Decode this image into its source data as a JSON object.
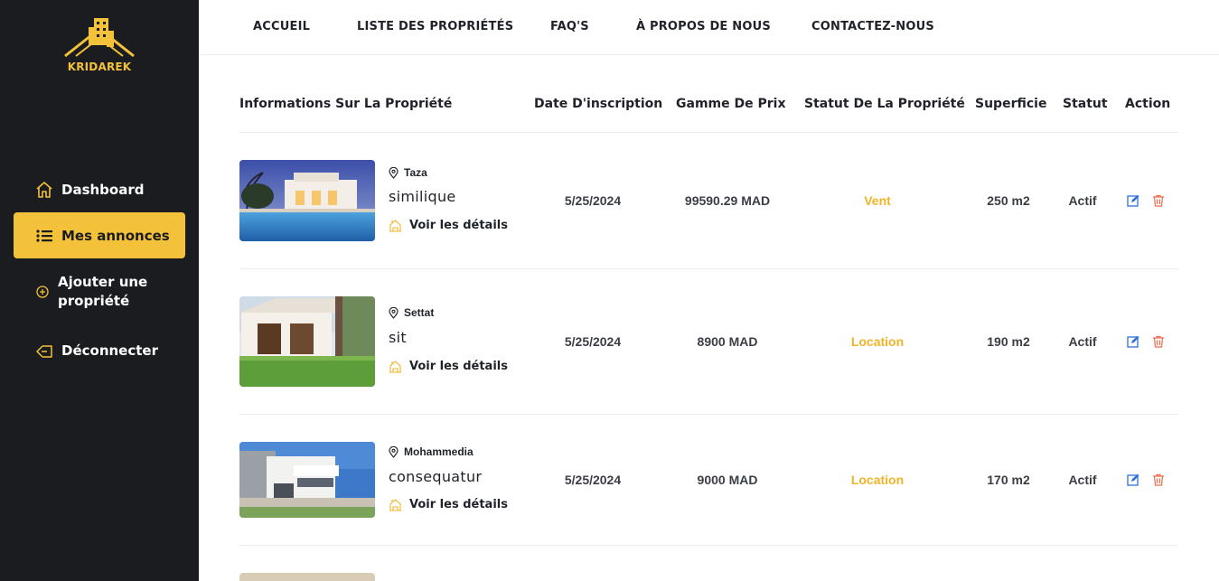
{
  "brand": {
    "name": "KRIDAREK",
    "accent": "#f4c13a"
  },
  "sidebar": {
    "items": [
      {
        "label": "Dashboard",
        "icon": "home-icon",
        "active": false
      },
      {
        "label": "Mes annonces",
        "icon": "list-icon",
        "active": true
      },
      {
        "label": "Ajouter une propriété",
        "icon": "plus-circle-icon",
        "active": false
      },
      {
        "label": "Déconnecter",
        "icon": "logout-icon",
        "active": false
      }
    ]
  },
  "topnav": {
    "items": [
      "ACCUEIL",
      "LISTE DES PROPRIÉTÉS",
      "FAQ'S",
      "À PROPOS DE NOUS",
      "CONTACTEZ-NOUS"
    ]
  },
  "table": {
    "headers": [
      "Informations Sur La Propriété",
      "Date D'inscription",
      "Gamme De Prix",
      "Statut De La Propriété",
      "Superficie",
      "Statut",
      "Action"
    ],
    "details_label": "Voir les détails",
    "rows": [
      {
        "city": "Taza",
        "title": "similique",
        "date": "5/25/2024",
        "price": "99590.29 MAD",
        "property_status": "Vent",
        "area": "250 m2",
        "status": "Actif"
      },
      {
        "city": "Settat",
        "title": "sit",
        "date": "5/25/2024",
        "price": "8900 MAD",
        "property_status": "Location",
        "area": "190 m2",
        "status": "Actif"
      },
      {
        "city": "Mohammedia",
        "title": "consequatur",
        "date": "5/25/2024",
        "price": "9000 MAD",
        "property_status": "Location",
        "area": "170 m2",
        "status": "Actif"
      }
    ]
  },
  "colors": {
    "sidebar_bg": "#1a1c20",
    "accent": "#f4c13a",
    "status_accent": "#f0b429",
    "edit_icon": "#2f6fd8",
    "delete_icon": "#ef6a4a"
  }
}
